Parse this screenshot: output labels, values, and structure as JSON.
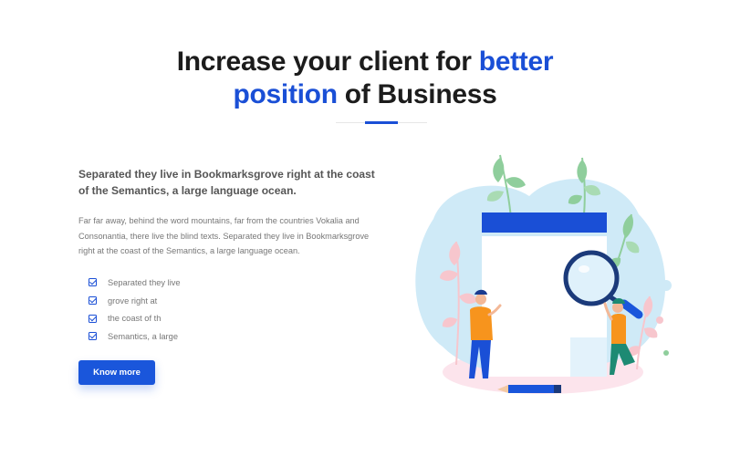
{
  "hero": {
    "title_part1": "Increase your client for ",
    "title_accent1": "better",
    "title_accent2": "position",
    "title_part2": " of Business"
  },
  "content": {
    "lead": "Separated they live in Bookmarksgrove right at the coast of the Semantics, a large language ocean.",
    "body": "Far far away, behind the word mountains, far from the countries Vokalia and Consonantia, there live the blind texts. Separated they live in Bookmarksgrove right at the coast of the Semantics, a large language ocean.",
    "checklist": [
      "Separated they live",
      "grove right at",
      "the coast of th",
      "Semantics, a large"
    ],
    "button_label": "Know more"
  },
  "colors": {
    "accent": "#1a4fd6",
    "button": "#1a56db",
    "blob": "#cfeaf7",
    "leaf_green": "#8fce9c",
    "leaf_pink": "#f7c6cd"
  },
  "icons": {
    "check": "checkbox-check-icon",
    "illustration": "magnifier-document-illustration"
  }
}
